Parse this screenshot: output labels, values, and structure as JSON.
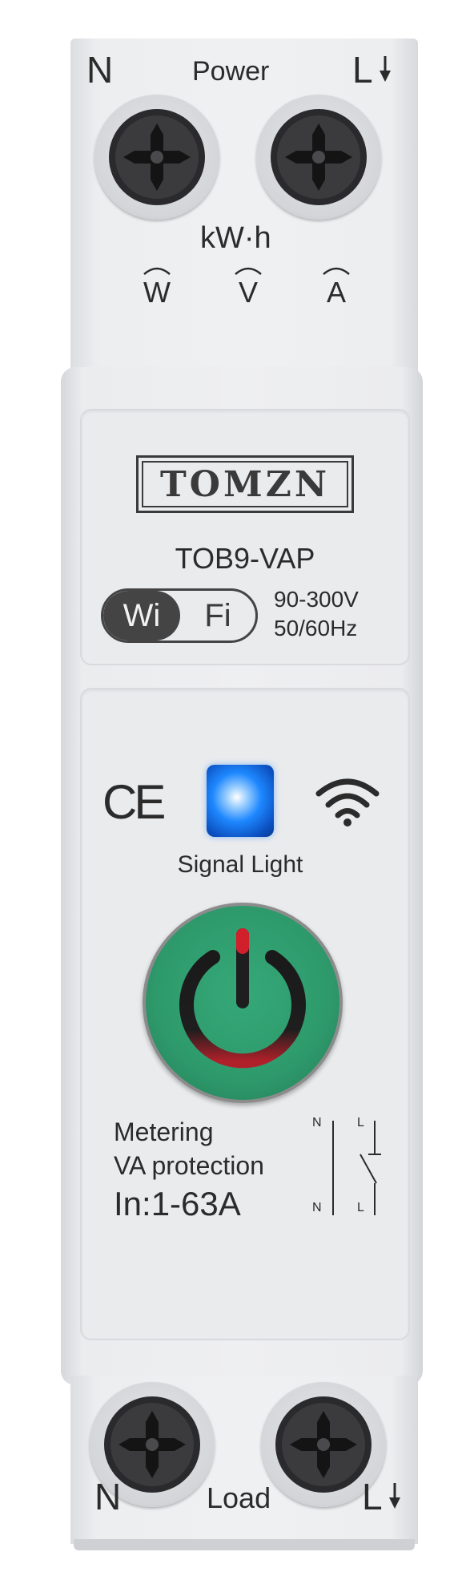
{
  "top": {
    "left_terminal_letter": "N",
    "power_label": "Power",
    "right_terminal_letter": "L",
    "energy_unit": "kW·h",
    "measure_symbols": [
      "W",
      "V",
      "A"
    ]
  },
  "label": {
    "brand": "TOMZN",
    "model": "TOB9-VAP",
    "wifi_left": "Wi",
    "wifi_right": "Fi",
    "voltage": "90-300V",
    "frequency": "50/60Hz"
  },
  "front": {
    "ce_mark": "CE",
    "signal_light_label": "Signal Light",
    "feature_1": "Metering",
    "feature_2": "VA protection",
    "rating": "In:1-63A",
    "diagram_top_n": "N",
    "diagram_top_l": "L",
    "diagram_bottom_n": "N",
    "diagram_bottom_l": "L"
  },
  "bottom": {
    "left_terminal_letter": "N",
    "load_label": "Load",
    "right_terminal_letter": "L"
  },
  "colors": {
    "body": "#eeeff1",
    "button_green": "#2e9a6c",
    "button_red": "#d21f2c",
    "led_blue": "#1e88ff",
    "text": "#2b2b2b"
  },
  "icons": [
    "down-arrow-icon",
    "screw-terminal-icon",
    "wifi-icon",
    "power-icon",
    "switch-diagram-icon"
  ]
}
